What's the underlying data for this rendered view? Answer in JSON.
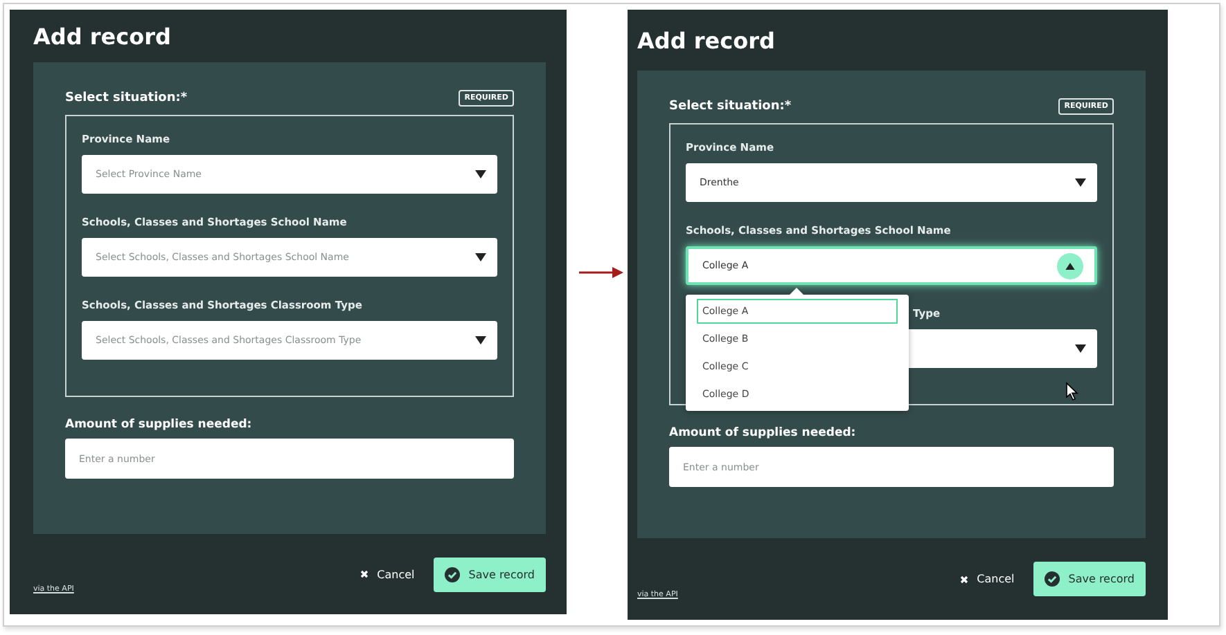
{
  "panels": [
    {
      "title": "Add record",
      "section_label": "Select situation:*",
      "required_badge": "REQUIRED",
      "fields": [
        {
          "label": "Province Name",
          "placeholder": "Select Province Name",
          "open": false
        },
        {
          "label": "Schools, Classes and Shortages School Name",
          "placeholder": "Select Schools, Classes and Shortages School Name",
          "open": false
        },
        {
          "label": "Schools, Classes and Shortages Classroom Type",
          "placeholder": "Select Schools, Classes and Shortages Classroom Type",
          "open": false
        }
      ],
      "amount": {
        "label": "Amount of supplies needed:",
        "placeholder": "Enter a number"
      },
      "link": "via the API",
      "cancel": "Cancel",
      "save": "Save record"
    },
    {
      "title": "Add record",
      "section_label": "Select situation:*",
      "required_badge": "REQUIRED",
      "fields": [
        {
          "label": "Province Name",
          "value": "Drenthe",
          "open": false
        },
        {
          "label": "Schools, Classes and Shortages School Name",
          "value": "College A",
          "open": true,
          "options": [
            {
              "label": "College A",
              "selected": true
            },
            {
              "label": "College B",
              "selected": false
            },
            {
              "label": "College C",
              "selected": false
            },
            {
              "label": "College D",
              "selected": false
            }
          ]
        },
        {
          "label": "Type",
          "open": false
        }
      ],
      "amount": {
        "label": "Amount of supplies needed:",
        "placeholder": "Enter a number"
      },
      "link": "via the API",
      "cancel": "Cancel",
      "save": "Save record"
    }
  ]
}
